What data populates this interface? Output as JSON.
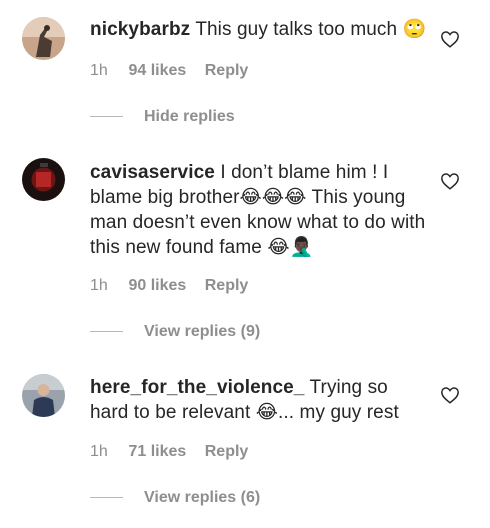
{
  "comments": [
    {
      "username": "nickybarbz",
      "text": "This guy talks too much 🙄",
      "time": "1h",
      "likes": "94 likes",
      "reply_label": "Reply",
      "replies_toggle": "Hide replies"
    },
    {
      "username": "cavisaservice",
      "text": "I don’t blame him ! I blame big brother😂😂😂 This young man doesn’t even know what to do with this new found fame 😂🤦🏿‍♂️",
      "time": "1h",
      "likes": "90 likes",
      "reply_label": "Reply",
      "replies_toggle": "View replies (9)"
    },
    {
      "username": "here_for_the_violence_",
      "text": "Trying so hard to be relevant 😂... my guy rest",
      "time": "1h",
      "likes": "71 likes",
      "reply_label": "Reply",
      "replies_toggle": "View replies (6)"
    }
  ],
  "icons": {
    "like": "heart-outline-icon"
  },
  "colors": {
    "text": "#262626",
    "secondary": "#8e8e8e"
  }
}
